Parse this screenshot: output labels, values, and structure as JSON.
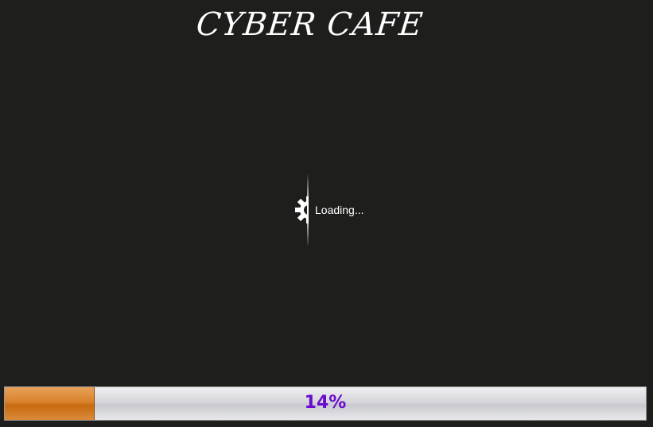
{
  "header": {
    "title": "CYBER CAFE"
  },
  "loader": {
    "icon": "gear-icon",
    "text": "Loading..."
  },
  "progress": {
    "value": 0.14,
    "label": "14%",
    "fill_color": "#d9822b",
    "label_color": "#6a0bcf"
  },
  "colors": {
    "background": "#1e1f1d"
  }
}
